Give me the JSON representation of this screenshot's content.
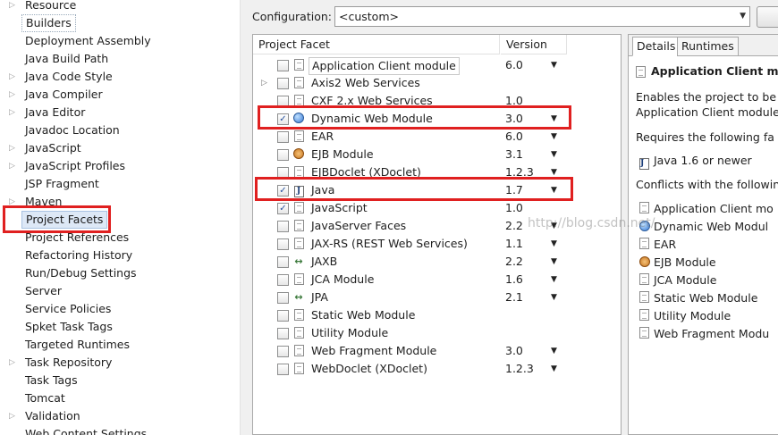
{
  "nav": {
    "items": [
      {
        "label": "Resource",
        "expandable": true
      },
      {
        "label": "Builders",
        "expandable": false
      },
      {
        "label": "Deployment Assembly",
        "expandable": false
      },
      {
        "label": "Java Build Path",
        "expandable": false
      },
      {
        "label": "Java Code Style",
        "expandable": true
      },
      {
        "label": "Java Compiler",
        "expandable": true
      },
      {
        "label": "Java Editor",
        "expandable": true
      },
      {
        "label": "Javadoc Location",
        "expandable": false
      },
      {
        "label": "JavaScript",
        "expandable": true
      },
      {
        "label": "JavaScript Profiles",
        "expandable": true
      },
      {
        "label": "JSP Fragment",
        "expandable": false
      },
      {
        "label": "Maven",
        "expandable": true
      },
      {
        "label": "Project Facets",
        "expandable": false
      },
      {
        "label": "Project References",
        "expandable": false
      },
      {
        "label": "Refactoring History",
        "expandable": false
      },
      {
        "label": "Run/Debug Settings",
        "expandable": false
      },
      {
        "label": "Server",
        "expandable": false
      },
      {
        "label": "Service Policies",
        "expandable": false
      },
      {
        "label": "Spket Task Tags",
        "expandable": false
      },
      {
        "label": "Targeted Runtimes",
        "expandable": false
      },
      {
        "label": "Task Repository",
        "expandable": true
      },
      {
        "label": "Task Tags",
        "expandable": false
      },
      {
        "label": "Tomcat",
        "expandable": false
      },
      {
        "label": "Validation",
        "expandable": true
      },
      {
        "label": "Web Content Settings",
        "expandable": false
      }
    ]
  },
  "config": {
    "label": "Configuration:",
    "value": "<custom>"
  },
  "facets": {
    "header_facet": "Project Facet",
    "header_version": "Version",
    "rows": [
      {
        "name": "Application Client module",
        "version": "6.0",
        "checked": false,
        "icon": "page-icon",
        "has_dropdown": true
      },
      {
        "name": "Axis2 Web Services",
        "version": "",
        "checked": false,
        "icon": "page-icon",
        "has_dropdown": false
      },
      {
        "name": "CXF 2.x Web Services",
        "version": "1.0",
        "checked": false,
        "icon": "page-icon",
        "has_dropdown": false
      },
      {
        "name": "Dynamic Web Module",
        "version": "3.0",
        "checked": true,
        "icon": "globe-icon",
        "has_dropdown": true
      },
      {
        "name": "EAR",
        "version": "6.0",
        "checked": false,
        "icon": "page-icon",
        "has_dropdown": true
      },
      {
        "name": "EJB Module",
        "version": "3.1",
        "checked": false,
        "icon": "bean-icon",
        "has_dropdown": true
      },
      {
        "name": "EJBDoclet (XDoclet)",
        "version": "1.2.3",
        "checked": false,
        "icon": "page-icon",
        "has_dropdown": true
      },
      {
        "name": "Java",
        "version": "1.7",
        "checked": true,
        "icon": "java-icon",
        "has_dropdown": true
      },
      {
        "name": "JavaScript",
        "version": "1.0",
        "checked": true,
        "icon": "page-icon",
        "has_dropdown": false
      },
      {
        "name": "JavaServer Faces",
        "version": "2.2",
        "checked": false,
        "icon": "page-icon",
        "has_dropdown": true
      },
      {
        "name": "JAX-RS (REST Web Services)",
        "version": "1.1",
        "checked": false,
        "icon": "page-icon",
        "has_dropdown": true
      },
      {
        "name": "JAXB",
        "version": "2.2",
        "checked": false,
        "icon": "arrows-icon",
        "has_dropdown": true
      },
      {
        "name": "JCA Module",
        "version": "1.6",
        "checked": false,
        "icon": "page-icon",
        "has_dropdown": true
      },
      {
        "name": "JPA",
        "version": "2.1",
        "checked": false,
        "icon": "arrows-icon",
        "has_dropdown": true
      },
      {
        "name": "Static Web Module",
        "version": "",
        "checked": false,
        "icon": "page-icon",
        "has_dropdown": false
      },
      {
        "name": "Utility Module",
        "version": "",
        "checked": false,
        "icon": "page-icon",
        "has_dropdown": false
      },
      {
        "name": "Web Fragment Module",
        "version": "3.0",
        "checked": false,
        "icon": "page-icon",
        "has_dropdown": true
      },
      {
        "name": "WebDoclet (XDoclet)",
        "version": "1.2.3",
        "checked": false,
        "icon": "page-icon",
        "has_dropdown": true
      }
    ]
  },
  "details": {
    "tab_details": "Details",
    "tab_runtimes": "Runtimes",
    "title": "Application Client m",
    "desc1": "Enables the project to be",
    "desc2": "Application Client module",
    "requires": "Requires the following fa",
    "requires_item": "Java 1.6 or newer",
    "conflicts": "Conflicts with the followin",
    "conflict_items": [
      "Application Client mo",
      "Dynamic Web Modul",
      "EAR",
      "EJB Module",
      "JCA Module",
      "Static Web Module",
      "Utility Module",
      "Web Fragment Modu"
    ]
  },
  "watermark": "http://blog.csdn.net/",
  "colors": {
    "highlight_red": "#e02020",
    "selection_bg": "#dde8f6"
  }
}
